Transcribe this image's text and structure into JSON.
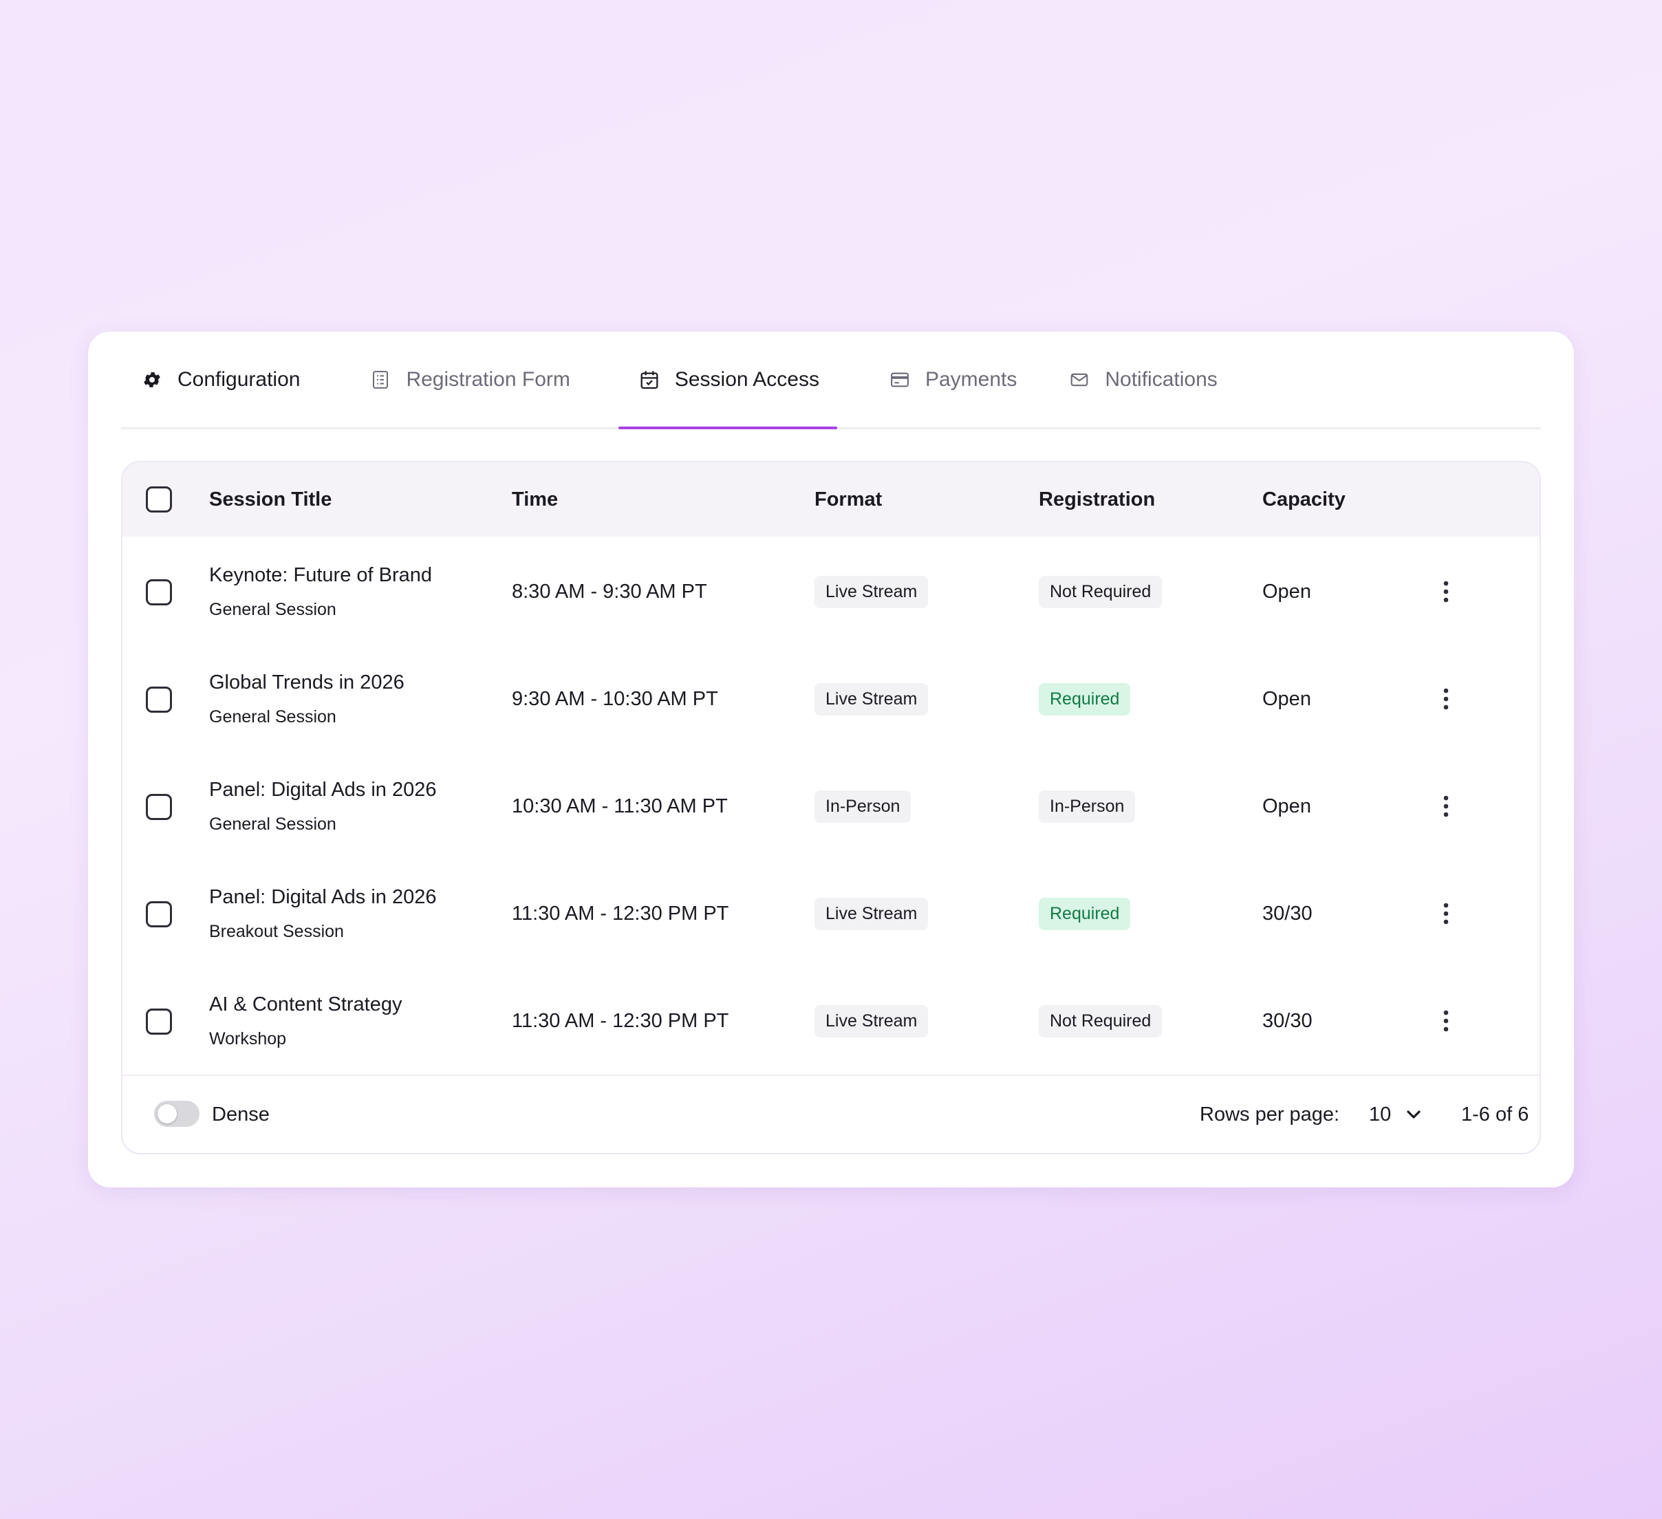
{
  "tabs": [
    {
      "label": "Configuration",
      "icon": "gear-icon"
    },
    {
      "label": "Registration Form",
      "icon": "form-icon"
    },
    {
      "label": "Session Access",
      "icon": "calendar-check-icon"
    },
    {
      "label": "Payments",
      "icon": "credit-card-icon"
    },
    {
      "label": "Notifications",
      "icon": "mail-icon"
    }
  ],
  "active_tab": "Session Access",
  "accent_color": "#a743e2",
  "table": {
    "headers": {
      "title": "Session Title",
      "time": "Time",
      "format": "Format",
      "registration": "Registration",
      "capacity": "Capacity"
    },
    "rows": [
      {
        "title": "Keynote: Future of Brand",
        "type": "General Session",
        "time": "8:30 AM - 9:30 AM PT",
        "format": "Live Stream",
        "registration": "Not Required",
        "registration_style": "neutral",
        "capacity": "Open"
      },
      {
        "title": "Global Trends in 2026",
        "type": "General Session",
        "time": "9:30 AM - 10:30 AM PT",
        "format": "Live Stream",
        "registration": "Required",
        "registration_style": "green",
        "capacity": "Open"
      },
      {
        "title": "Panel: Digital Ads in 2026",
        "type": "General Session",
        "time": "10:30 AM - 11:30 AM PT",
        "format": "In-Person",
        "registration": "In-Person",
        "registration_style": "neutral",
        "capacity": "Open"
      },
      {
        "title": "Panel: Digital Ads in 2026",
        "type": "Breakout Session",
        "time": "11:30 AM - 12:30 PM PT",
        "format": "Live Stream",
        "registration": "Required",
        "registration_style": "green",
        "capacity": "30/30"
      },
      {
        "title": "AI & Content Strategy",
        "type": "Workshop",
        "time": "11:30 AM - 12:30 PM PT",
        "format": "Live Stream",
        "registration": "Not Required",
        "registration_style": "neutral",
        "capacity": "30/30"
      }
    ]
  },
  "footer": {
    "dense_label": "Dense",
    "dense_on": false,
    "rows_per_page_label": "Rows per page:",
    "rows_per_page_value": "10",
    "range_text": "1-6 of 6"
  }
}
